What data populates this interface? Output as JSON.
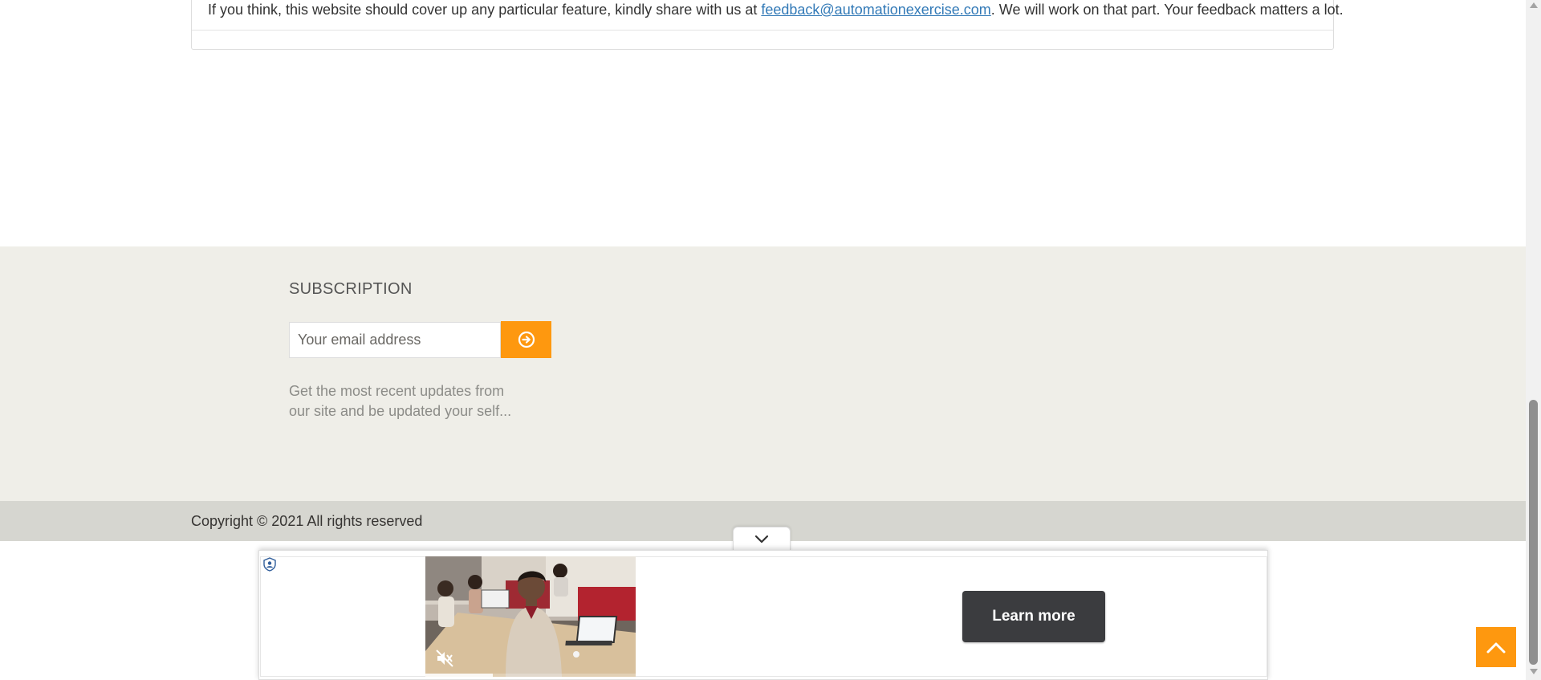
{
  "feedback": {
    "text_before": "If you think, this website should cover up any particular feature, kindly share with us at ",
    "email_link": "feedback@automationexercise.com",
    "text_after": ". We will work on that part. Your feedback matters a lot."
  },
  "footer": {
    "subscription_title": "SUBSCRIPTION",
    "email_placeholder": "Your email address",
    "email_value": "",
    "subscribe_icon": "arrow-circle-right-icon",
    "description_line1": "Get the most recent updates from",
    "description_line2": "our site and be updated your self...",
    "copyright": "Copyright © 2021 All rights reserved"
  },
  "ad": {
    "collapse_icon": "chevron-down-icon",
    "badge_icon": "shield-icon",
    "mute_icon": "muted-speaker-icon",
    "video_progress": 0.32,
    "cta_label": "Learn more"
  },
  "scroll_up_icon": "chevron-up-icon",
  "colors": {
    "accent": "#fe980f",
    "footer_widget_bg": "#efeee8",
    "footer_bottom_bg": "#d6d6d0",
    "link": "#337ab7",
    "cta_bg": "#3b3c3f"
  }
}
